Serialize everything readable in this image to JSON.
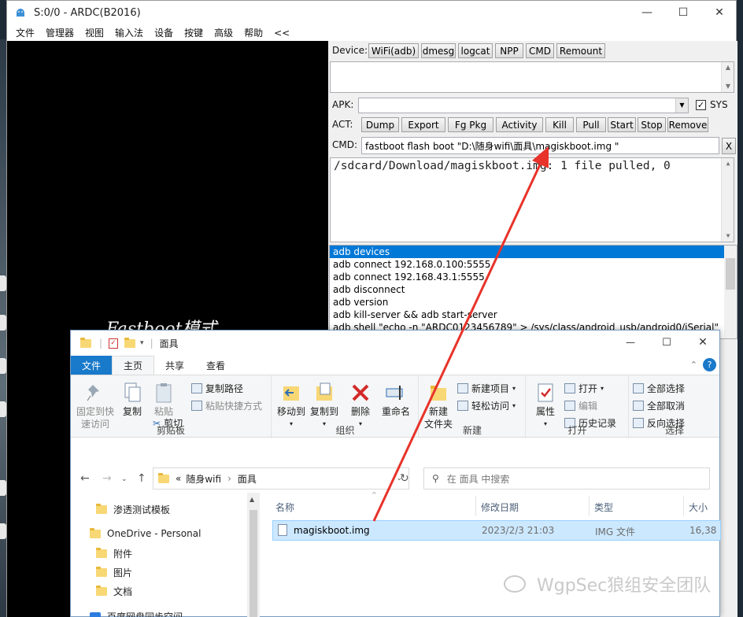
{
  "ardc": {
    "title": "S:0/0 - ARDC(B2016)",
    "menu": [
      "文件",
      "管理器",
      "视图",
      "输入法",
      "设备",
      "按键",
      "高级",
      "帮助",
      "<<"
    ],
    "screen_text": "Fastboot模式",
    "device_label": "Device:",
    "device_buttons": [
      "WiFi(adb)",
      "dmesg",
      "logcat",
      "NPP",
      "CMD",
      "Remount"
    ],
    "apk_label": "APK:",
    "sys_label": "SYS",
    "act_label": "ACT:",
    "act_buttons": [
      "Dump",
      "Export",
      "Fg Pkg",
      "Activity",
      "Kill",
      "Pull",
      "Start",
      "Stop",
      "Remove"
    ],
    "cmd_label": "CMD:",
    "cmd_value": "fastboot flash boot  \"D:\\随身wifi\\面具\\magiskboot.img \"",
    "cmd_clear": "X",
    "output": "/sdcard/Download/magiskboot.img: 1 file pulled, 0",
    "history": [
      "adb devices",
      "adb connect 192.168.0.100:5555",
      "adb connect 192.168.43.1:5555",
      "adb disconnect",
      "adb version",
      "adb kill-server && adb start-server",
      "adb shell \"echo -n \"ARDC0123456789\" > /sys/class/android_usb/android0/iSerial\""
    ]
  },
  "explorer": {
    "title": "面具",
    "tabs": [
      "文件",
      "主页",
      "共享",
      "查看"
    ],
    "groups": {
      "clipboard": {
        "label": "剪贴板",
        "pin": "固定到快速访问",
        "copy": "复制",
        "paste": "粘贴",
        "copy_path": "复制路径",
        "paste_shortcut": "粘贴快捷方式",
        "cut": "剪切"
      },
      "organize": {
        "label": "组织",
        "move_to": "移动到",
        "copy_to": "复制到",
        "delete": "删除",
        "rename": "重命名"
      },
      "new": {
        "label": "新建",
        "new_folder": "新建\n文件夹",
        "new_item": "新建项目",
        "easy_access": "轻松访问"
      },
      "open": {
        "label": "打开",
        "properties": "属性",
        "open": "打开",
        "edit": "编辑",
        "history": "历史记录"
      },
      "select": {
        "label": "选择",
        "select_all": "全部选择",
        "select_none": "全部取消",
        "invert": "反向选择"
      }
    },
    "address": {
      "prefix": "«",
      "path1": "随身wifi",
      "path2": "面具"
    },
    "search_placeholder": "在 面具 中搜索",
    "nav_items": [
      "渗透测试模板",
      "OneDrive - Personal",
      "附件",
      "图片",
      "文档",
      "百度网盘同步空间"
    ],
    "columns": [
      "名称",
      "修改日期",
      "类型",
      "大小"
    ],
    "files": [
      {
        "name": "magiskboot.img",
        "date": "2023/2/3 21:03",
        "type": "IMG 文件",
        "size": "16,38"
      }
    ]
  },
  "watermark": "WgpSec狼组安全团队",
  "colors": {
    "accent": "#0078d7",
    "file_tab": "#1979ca",
    "arrow": "#e8332a",
    "selection": "#cce8ff"
  }
}
